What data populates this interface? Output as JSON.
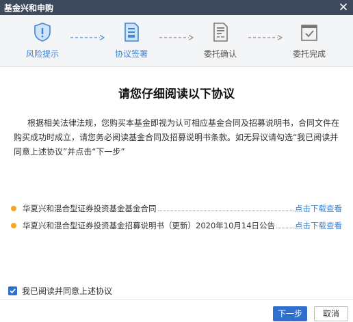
{
  "window": {
    "title": "基金兴和申购"
  },
  "steps": [
    {
      "label": "风险提示",
      "icon": "shield-icon",
      "active": true
    },
    {
      "label": "协议签署",
      "icon": "document-sign-icon",
      "active": true
    },
    {
      "label": "委托确认",
      "icon": "document-confirm-icon",
      "active": false
    },
    {
      "label": "委托完成",
      "icon": "checkbox-complete-icon",
      "active": false
    }
  ],
  "main": {
    "heading": "请您仔细阅读以下协议",
    "paragraph": "根据相关法律法规，您购买本基金即视为认可相应基金合同及招募说明书，合同文件在购买成功时成立，请您务必阅读基金合同及招募说明书条款。如无异议请勾选“我已阅读并同意上述协议”并点击“下一步”",
    "documents": [
      {
        "name": "华夏兴和混合型证券投资基金基金合同",
        "link": "点击下载查看"
      },
      {
        "name": "华夏兴和混合型证券投资基金招募说明书（更新）2020年10月14日公告",
        "link": "点击下载查看"
      }
    ]
  },
  "agreement": {
    "label": "我已阅读并同意上述协议",
    "checked": true
  },
  "footer": {
    "next_label": "下一步",
    "cancel_label": "取消"
  },
  "colors": {
    "accent": "#3a86d8",
    "primary_button": "#2f6fce",
    "bullet": "#f5a623",
    "titlebar": "#3d4a5e"
  }
}
